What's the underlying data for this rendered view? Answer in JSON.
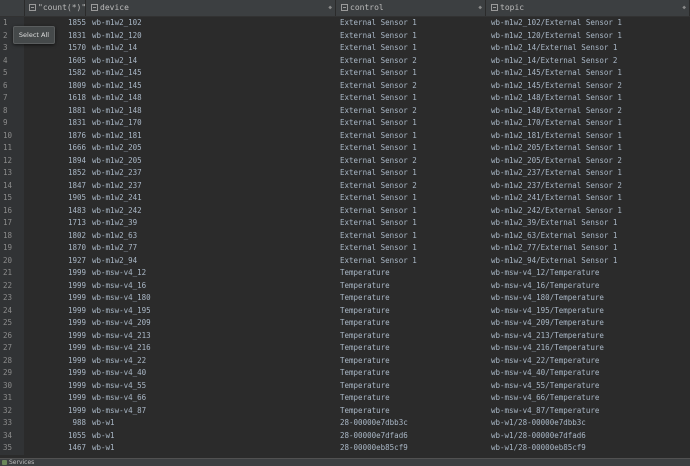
{
  "columns": [
    {
      "key": "count",
      "label": "\"count(*)\""
    },
    {
      "key": "device",
      "label": "device"
    },
    {
      "key": "control",
      "label": "control"
    },
    {
      "key": "topic",
      "label": "topic"
    }
  ],
  "rows": [
    {
      "n": "1",
      "count": "1855",
      "device": "wb-m1w2_102",
      "control": "External Sensor 1",
      "topic": "wb-m1w2_102/External Sensor 1"
    },
    {
      "n": "2",
      "count": "1831",
      "device": "wb-m1w2_120",
      "control": "External Sensor 1",
      "topic": "wb-m1w2_120/External Sensor 1"
    },
    {
      "n": "3",
      "count": "1570",
      "device": "wb-m1w2_14",
      "control": "External Sensor 1",
      "topic": "wb-m1w2_14/External Sensor 1"
    },
    {
      "n": "4",
      "count": "1605",
      "device": "wb-m1w2_14",
      "control": "External Sensor 2",
      "topic": "wb-m1w2_14/External Sensor 2"
    },
    {
      "n": "5",
      "count": "1582",
      "device": "wb-m1w2_145",
      "control": "External Sensor 1",
      "topic": "wb-m1w2_145/External Sensor 1"
    },
    {
      "n": "6",
      "count": "1809",
      "device": "wb-m1w2_145",
      "control": "External Sensor 2",
      "topic": "wb-m1w2_145/External Sensor 2"
    },
    {
      "n": "7",
      "count": "1618",
      "device": "wb-m1w2_148",
      "control": "External Sensor 1",
      "topic": "wb-m1w2_148/External Sensor 1"
    },
    {
      "n": "8",
      "count": "1881",
      "device": "wb-m1w2_148",
      "control": "External Sensor 2",
      "topic": "wb-m1w2_148/External Sensor 2"
    },
    {
      "n": "9",
      "count": "1831",
      "device": "wb-m1w2_170",
      "control": "External Sensor 1",
      "topic": "wb-m1w2_170/External Sensor 1"
    },
    {
      "n": "10",
      "count": "1876",
      "device": "wb-m1w2_181",
      "control": "External Sensor 1",
      "topic": "wb-m1w2_181/External Sensor 1"
    },
    {
      "n": "11",
      "count": "1666",
      "device": "wb-m1w2_205",
      "control": "External Sensor 1",
      "topic": "wb-m1w2_205/External Sensor 1"
    },
    {
      "n": "12",
      "count": "1894",
      "device": "wb-m1w2_205",
      "control": "External Sensor 2",
      "topic": "wb-m1w2_205/External Sensor 2"
    },
    {
      "n": "13",
      "count": "1852",
      "device": "wb-m1w2_237",
      "control": "External Sensor 1",
      "topic": "wb-m1w2_237/External Sensor 1"
    },
    {
      "n": "14",
      "count": "1847",
      "device": "wb-m1w2_237",
      "control": "External Sensor 2",
      "topic": "wb-m1w2_237/External Sensor 2"
    },
    {
      "n": "15",
      "count": "1905",
      "device": "wb-m1w2_241",
      "control": "External Sensor 1",
      "topic": "wb-m1w2_241/External Sensor 1"
    },
    {
      "n": "16",
      "count": "1483",
      "device": "wb-m1w2_242",
      "control": "External Sensor 1",
      "topic": "wb-m1w2_242/External Sensor 1"
    },
    {
      "n": "17",
      "count": "1713",
      "device": "wb-m1w2_39",
      "control": "External Sensor 1",
      "topic": "wb-m1w2_39/External Sensor 1"
    },
    {
      "n": "18",
      "count": "1802",
      "device": "wb-m1w2_63",
      "control": "External Sensor 1",
      "topic": "wb-m1w2_63/External Sensor 1"
    },
    {
      "n": "19",
      "count": "1870",
      "device": "wb-m1w2_77",
      "control": "External Sensor 1",
      "topic": "wb-m1w2_77/External Sensor 1"
    },
    {
      "n": "20",
      "count": "1927",
      "device": "wb-m1w2_94",
      "control": "External Sensor 1",
      "topic": "wb-m1w2_94/External Sensor 1"
    },
    {
      "n": "21",
      "count": "1999",
      "device": "wb-msw-v4_12",
      "control": "Temperature",
      "topic": "wb-msw-v4_12/Temperature"
    },
    {
      "n": "22",
      "count": "1999",
      "device": "wb-msw-v4_16",
      "control": "Temperature",
      "topic": "wb-msw-v4_16/Temperature"
    },
    {
      "n": "23",
      "count": "1999",
      "device": "wb-msw-v4_180",
      "control": "Temperature",
      "topic": "wb-msw-v4_180/Temperature"
    },
    {
      "n": "24",
      "count": "1999",
      "device": "wb-msw-v4_195",
      "control": "Temperature",
      "topic": "wb-msw-v4_195/Temperature"
    },
    {
      "n": "25",
      "count": "1999",
      "device": "wb-msw-v4_209",
      "control": "Temperature",
      "topic": "wb-msw-v4_209/Temperature"
    },
    {
      "n": "26",
      "count": "1999",
      "device": "wb-msw-v4_213",
      "control": "Temperature",
      "topic": "wb-msw-v4_213/Temperature"
    },
    {
      "n": "27",
      "count": "1999",
      "device": "wb-msw-v4_216",
      "control": "Temperature",
      "topic": "wb-msw-v4_216/Temperature"
    },
    {
      "n": "28",
      "count": "1999",
      "device": "wb-msw-v4_22",
      "control": "Temperature",
      "topic": "wb-msw-v4_22/Temperature"
    },
    {
      "n": "29",
      "count": "1999",
      "device": "wb-msw-v4_40",
      "control": "Temperature",
      "topic": "wb-msw-v4_40/Temperature"
    },
    {
      "n": "30",
      "count": "1999",
      "device": "wb-msw-v4_55",
      "control": "Temperature",
      "topic": "wb-msw-v4_55/Temperature"
    },
    {
      "n": "31",
      "count": "1999",
      "device": "wb-msw-v4_66",
      "control": "Temperature",
      "topic": "wb-msw-v4_66/Temperature"
    },
    {
      "n": "32",
      "count": "1999",
      "device": "wb-msw-v4_87",
      "control": "Temperature",
      "topic": "wb-msw-v4_87/Temperature"
    },
    {
      "n": "33",
      "count": "988",
      "device": "wb-w1",
      "control": "28-00000e7dbb3c",
      "topic": "wb-w1/28-00000e7dbb3c"
    },
    {
      "n": "34",
      "count": "1055",
      "device": "wb-w1",
      "control": "28-00000e7dfad6",
      "topic": "wb-w1/28-00000e7dfad6"
    },
    {
      "n": "35",
      "count": "1467",
      "device": "wb-w1",
      "control": "28-00000eb85cf9",
      "topic": "wb-w1/28-00000eb85cf9"
    }
  ],
  "tooltip": {
    "label": "Select All"
  },
  "statusbar": {
    "label": "Services"
  },
  "colors": {
    "background": "#2b2b2b",
    "header": "#3c3f41",
    "text": "#a9b7c6",
    "gutter_text": "#8c8c8c"
  }
}
